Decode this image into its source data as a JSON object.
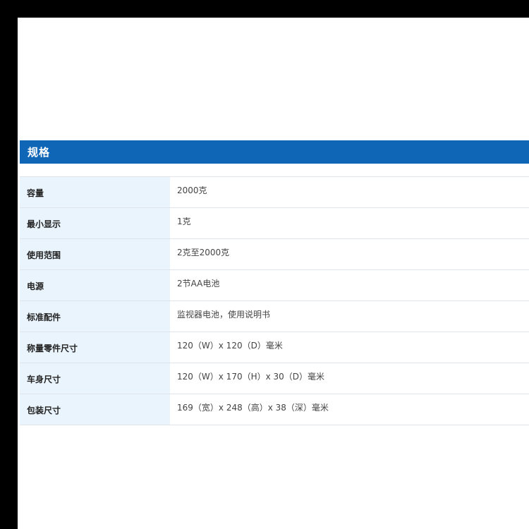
{
  "colors": {
    "header_bg": "#0f66b6",
    "label_bg": "#eaf4fd",
    "border": "#dfe4ea",
    "frame": "#000000"
  },
  "spec": {
    "title": "规格",
    "rows": [
      {
        "label": "容量",
        "value": "2000克"
      },
      {
        "label": "最小显示",
        "value": "1克"
      },
      {
        "label": "使用范围",
        "value": "2克至2000克"
      },
      {
        "label": "电源",
        "value": "2节AA电池"
      },
      {
        "label": "标准配件",
        "value": "监视器电池，使用说明书"
      },
      {
        "label": "称量零件尺寸",
        "value": "120（W）x 120（D）毫米"
      },
      {
        "label": "车身尺寸",
        "value": "120（W）x 170（H）x 30（D）毫米"
      },
      {
        "label": "包装尺寸",
        "value": "169（宽）x 248（高）x 38（深）毫米"
      }
    ]
  }
}
